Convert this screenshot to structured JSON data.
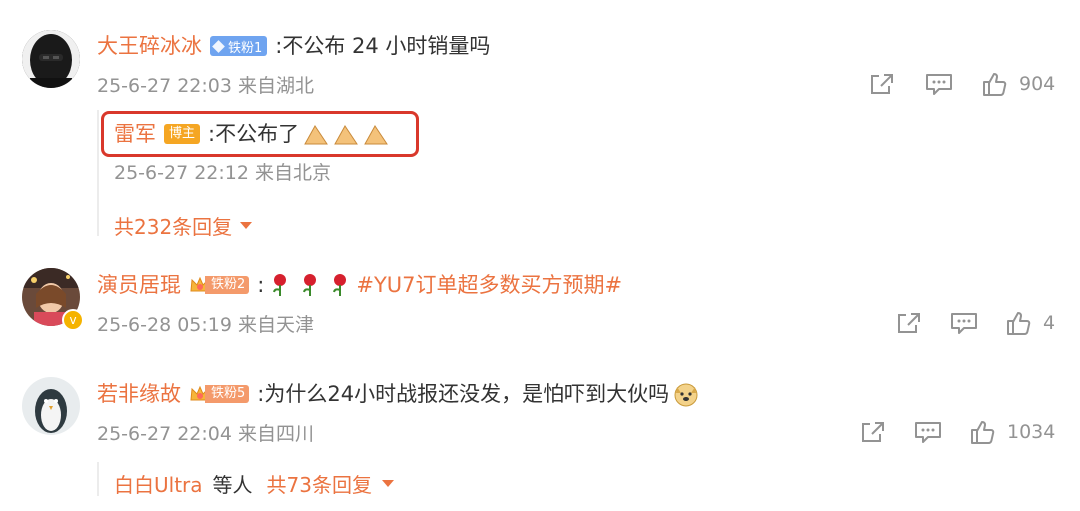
{
  "comments": [
    {
      "username": "大王碎冰冰",
      "badge": "铁粉1",
      "text": ":不公布 24 小时销量吗",
      "meta": "25-6-27 22:03 来自湖北",
      "likes": "904",
      "reply": {
        "username": "雷军",
        "badge": "博主",
        "text": ":不公布了",
        "meta": "25-6-27 22:12 来自北京",
        "more": "共232条回复"
      }
    },
    {
      "username": "演员居琨",
      "badge": "铁粉2",
      "text_prefix": ":",
      "text_hashtag": "#YU7订单超多数买方预期#",
      "meta": "25-6-28 05:19 来自天津",
      "likes": "4"
    },
    {
      "username": "若非缘故",
      "badge": "铁粉5",
      "text": ":为什么24小时战报还没发，是怕吓到大伙吗",
      "meta": "25-6-27 22:04 来自四川",
      "likes": "1034",
      "reply_summary": {
        "users": "白白Ultra",
        "suffix": "等人",
        "more": "共73条回复"
      }
    }
  ],
  "colors": {
    "username": "#eb7340",
    "meta": "#939393",
    "highlight_box": "#d9382b",
    "fan_badge": "#6fa4f0"
  },
  "icons": [
    "share-icon",
    "comment-icon",
    "like-icon",
    "caret-down-icon",
    "crown-icon",
    "diamond-icon",
    "rose-icon",
    "praying-hands-icon",
    "dog-face-icon"
  ]
}
